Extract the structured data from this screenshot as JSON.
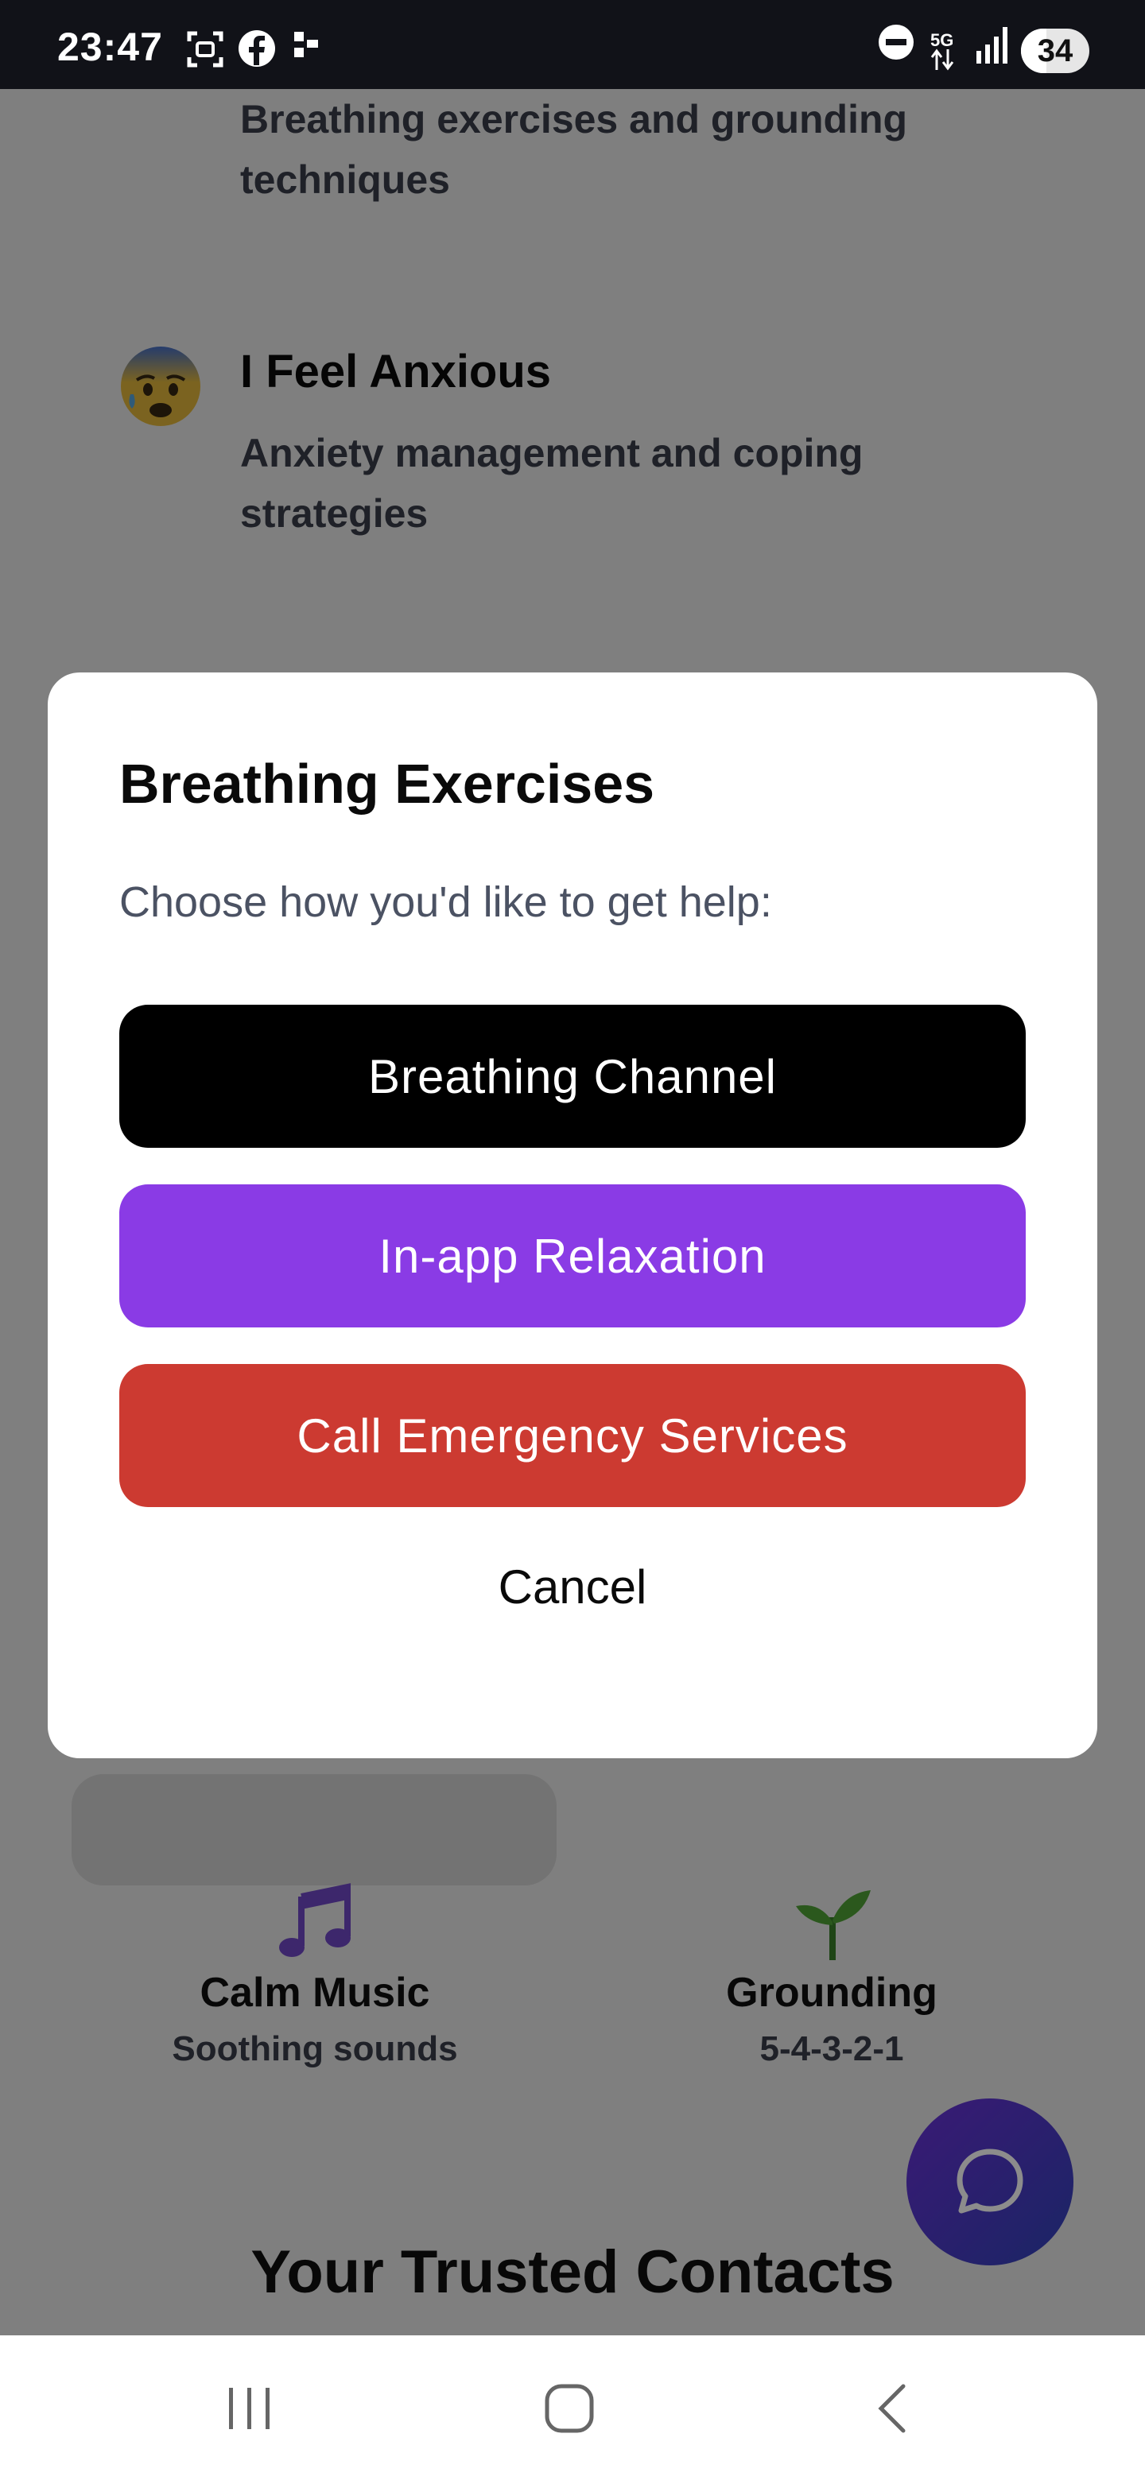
{
  "status_bar": {
    "time": "23:47",
    "network": "5G",
    "battery": "34",
    "icons": [
      "screenshot-icon",
      "facebook-icon",
      "app-notification-icon",
      "do-not-disturb-icon",
      "signal-icon",
      "battery-icon"
    ]
  },
  "background": {
    "items": [
      {
        "emoji": "",
        "title": "",
        "description": "Breathing exercises and grounding techniques"
      },
      {
        "emoji": "anxious-face-icon",
        "title": "I Feel Anxious",
        "description": "Anxiety management and coping strategies"
      }
    ],
    "quick_actions": [
      {
        "icon": "music-notes-icon",
        "title": "Calm Music",
        "subtitle": "Soothing sounds"
      },
      {
        "icon": "seedling-icon",
        "title": "Grounding",
        "subtitle": "5-4-3-2-1"
      }
    ],
    "trusted_heading": "Your Trusted Contacts",
    "chat_button_icon": "chat-bubble-icon"
  },
  "modal": {
    "title": "Breathing Exercises",
    "subtitle": "Choose how you'd like to get help:",
    "buttons": {
      "breathing_channel": "Breathing Channel",
      "in_app_relaxation": "In-app Relaxation",
      "call_emergency": "Call Emergency Services",
      "cancel": "Cancel"
    }
  },
  "colors": {
    "primary_black": "#000000",
    "purple": "#8a3be5",
    "red": "#cc3a31",
    "fab_gradient_start": "#6a2fd6",
    "fab_gradient_end": "#2f43b8"
  },
  "nav_bar": {
    "icons": [
      "recent-apps-icon",
      "home-icon",
      "back-icon"
    ]
  }
}
